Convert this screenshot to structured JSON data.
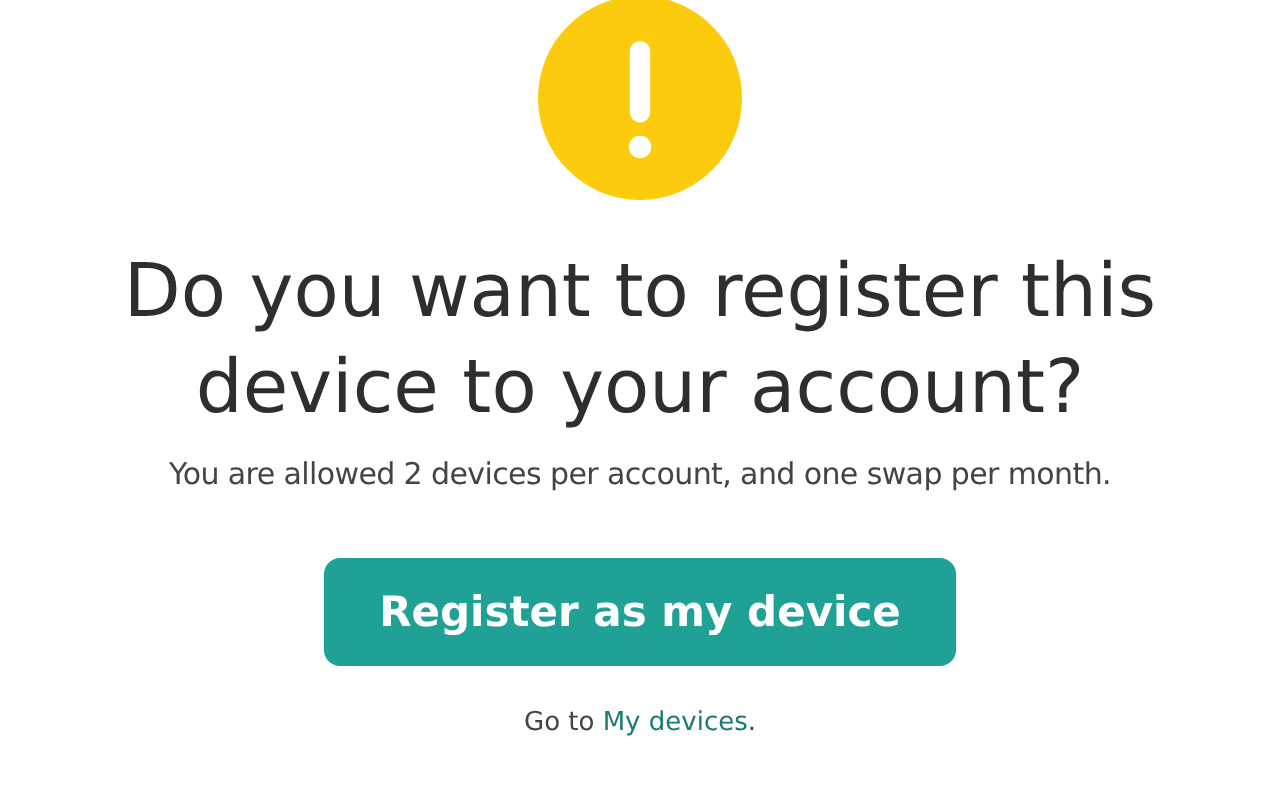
{
  "heading": "Do you want to register this device to your account?",
  "message": "You are allowed 2 devices per account, and one swap per month.",
  "primary_button": {
    "label": "Register as my device"
  },
  "footer": {
    "prefix": "Go to ",
    "link": "My devices",
    "suffix": "."
  }
}
